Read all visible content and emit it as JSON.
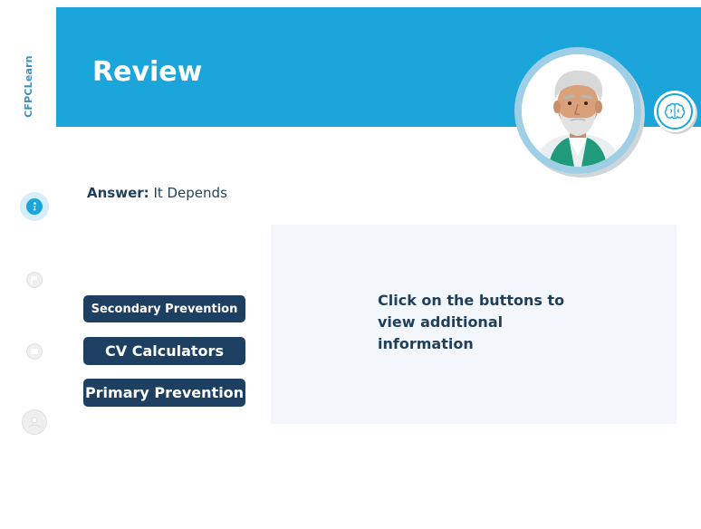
{
  "brand": {
    "name": "CFPCLearn"
  },
  "header": {
    "title": "Review"
  },
  "answer": {
    "label": "Answer:",
    "value": "It Depends"
  },
  "buttons": [
    {
      "label": "Secondary Prevention"
    },
    {
      "label": "CV Calculators"
    },
    {
      "label": "Primary Prevention"
    }
  ],
  "panel": {
    "text": "Click on the buttons to view additional information"
  },
  "colors": {
    "header_bg": "#1ba5da",
    "button_bg": "#1d3f61",
    "panel_bg": "#f3f6fa",
    "text_dark": "#1f3f5b"
  },
  "icons": {
    "sidebar": [
      "info-icon",
      "flag-icon",
      "notes-icon",
      "profile-icon"
    ],
    "header": [
      "brain-icon"
    ]
  }
}
